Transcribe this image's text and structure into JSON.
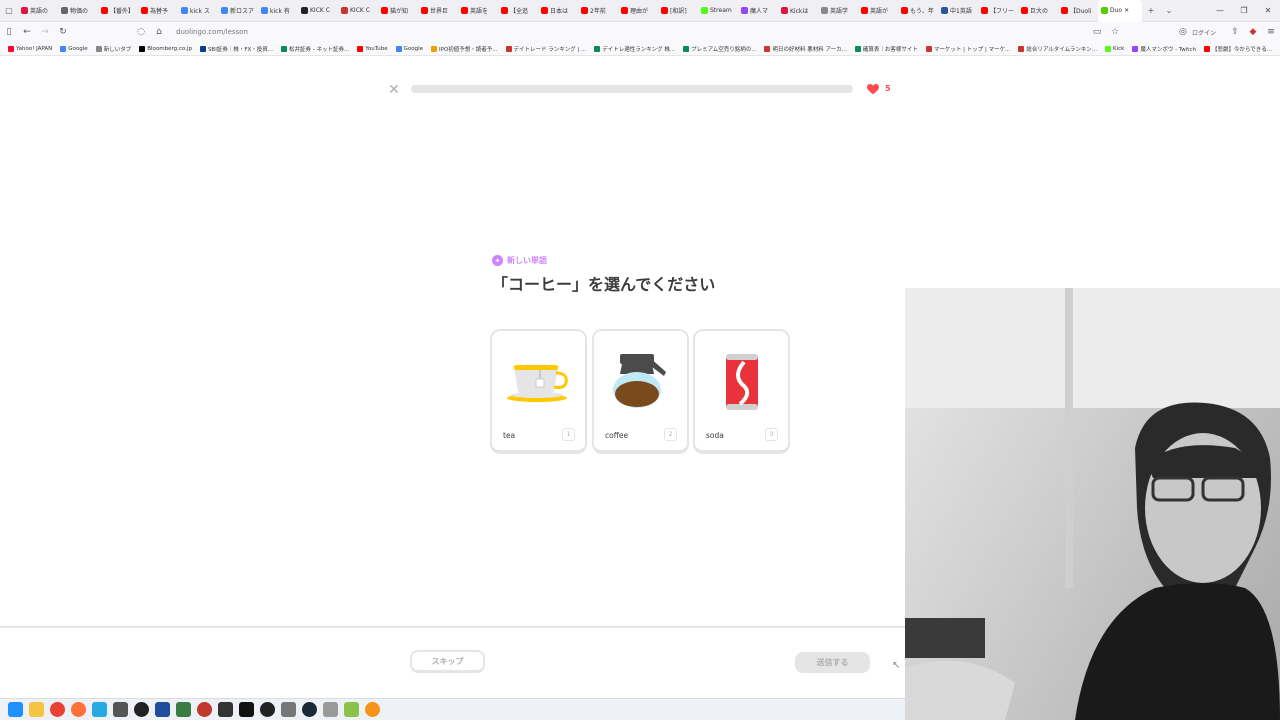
{
  "browser": {
    "tabs": [
      {
        "label": "英語の",
        "color": "#e0143c"
      },
      {
        "label": "物価の",
        "color": "#666666"
      },
      {
        "label": "【番外】",
        "color": "#ff0000"
      },
      {
        "label": "為替予",
        "color": "#ff0000"
      },
      {
        "label": "kick ス",
        "color": "#4285f4"
      },
      {
        "label": "新ロスア",
        "color": "#4285f4"
      },
      {
        "label": "kick 有",
        "color": "#4285f4"
      },
      {
        "label": "KICK C",
        "color": "#222222"
      },
      {
        "label": "KICK C",
        "color": "#c33"
      },
      {
        "label": "猫が知",
        "color": "#ff0000"
      },
      {
        "label": "世界巨",
        "color": "#ff0000"
      },
      {
        "label": "英語を",
        "color": "#ff0000"
      },
      {
        "label": "【全追",
        "color": "#ff0000"
      },
      {
        "label": "日本は",
        "color": "#ff0000"
      },
      {
        "label": "2年前",
        "color": "#ff0000"
      },
      {
        "label": "理由が",
        "color": "#ff0000"
      },
      {
        "label": "[和訳]",
        "color": "#ff0000"
      },
      {
        "label": "Stream",
        "color": "#53fc18"
      },
      {
        "label": "魔人マ",
        "color": "#9146ff"
      },
      {
        "label": "Kickは",
        "color": "#e0143c"
      },
      {
        "label": "英語学",
        "color": "#888888"
      },
      {
        "label": "英語が",
        "color": "#ff0000"
      },
      {
        "label": "もう、年",
        "color": "#ff0000"
      },
      {
        "label": "中1英語",
        "color": "#2b579a"
      },
      {
        "label": "【フリー",
        "color": "#ff0000"
      },
      {
        "label": "巨大の",
        "color": "#ff0000"
      },
      {
        "label": "【Duoli",
        "color": "#ff0000"
      },
      {
        "label": "Duo",
        "color": "#58cc02",
        "active": true
      }
    ],
    "new_tab": "+",
    "url": "duolingo.com/lesson",
    "login_label": "ログイン",
    "bookmarks": [
      {
        "label": "Yahoo! JAPAN",
        "color": "#ff0033"
      },
      {
        "label": "Google",
        "color": "#4285f4"
      },
      {
        "label": "新しいタブ",
        "color": "#888888"
      },
      {
        "label": "Bloomberg.co.jp",
        "color": "#000000"
      },
      {
        "label": "SBI証券｜株・FX・投資...",
        "color": "#0a3d91"
      },
      {
        "label": "松井証券 - ネット証券...",
        "color": "#0a8a5a"
      },
      {
        "label": "YouTube",
        "color": "#ff0000"
      },
      {
        "label": "Google",
        "color": "#4285f4"
      },
      {
        "label": "IPO初値予想・読者予...",
        "color": "#f0a000"
      },
      {
        "label": "デイトレード ランキング | ...",
        "color": "#c33"
      },
      {
        "label": "デイトレ適性ランキング 株...",
        "color": "#0a8a5a"
      },
      {
        "label": "プレミアム空売り銘柄の...",
        "color": "#0a8a5a"
      },
      {
        "label": "明日の好材料 悪材料 アーカ...",
        "color": "#c33"
      },
      {
        "label": "確算表｜お客様サイト",
        "color": "#0a8a5a"
      },
      {
        "label": "マーケット | トップ | マーケ...",
        "color": "#c33"
      },
      {
        "label": "総合リアルタイムランキン...",
        "color": "#c33"
      },
      {
        "label": "Kick",
        "color": "#53fc18"
      },
      {
        "label": "魔人マンボウ - Twitch",
        "color": "#9146ff"
      },
      {
        "label": "【悲劇】今からできる...",
        "color": "#ff0000"
      }
    ]
  },
  "lesson": {
    "progress": 0,
    "hearts": "5",
    "badge_label": "新しい単語",
    "prompt": "「コーヒー」を選んでください",
    "choices": [
      {
        "label": "tea",
        "number": "1"
      },
      {
        "label": "coffee",
        "number": "2"
      },
      {
        "label": "soda",
        "number": "3"
      }
    ],
    "skip_label": "スキップ",
    "submit_label": "送信する"
  }
}
